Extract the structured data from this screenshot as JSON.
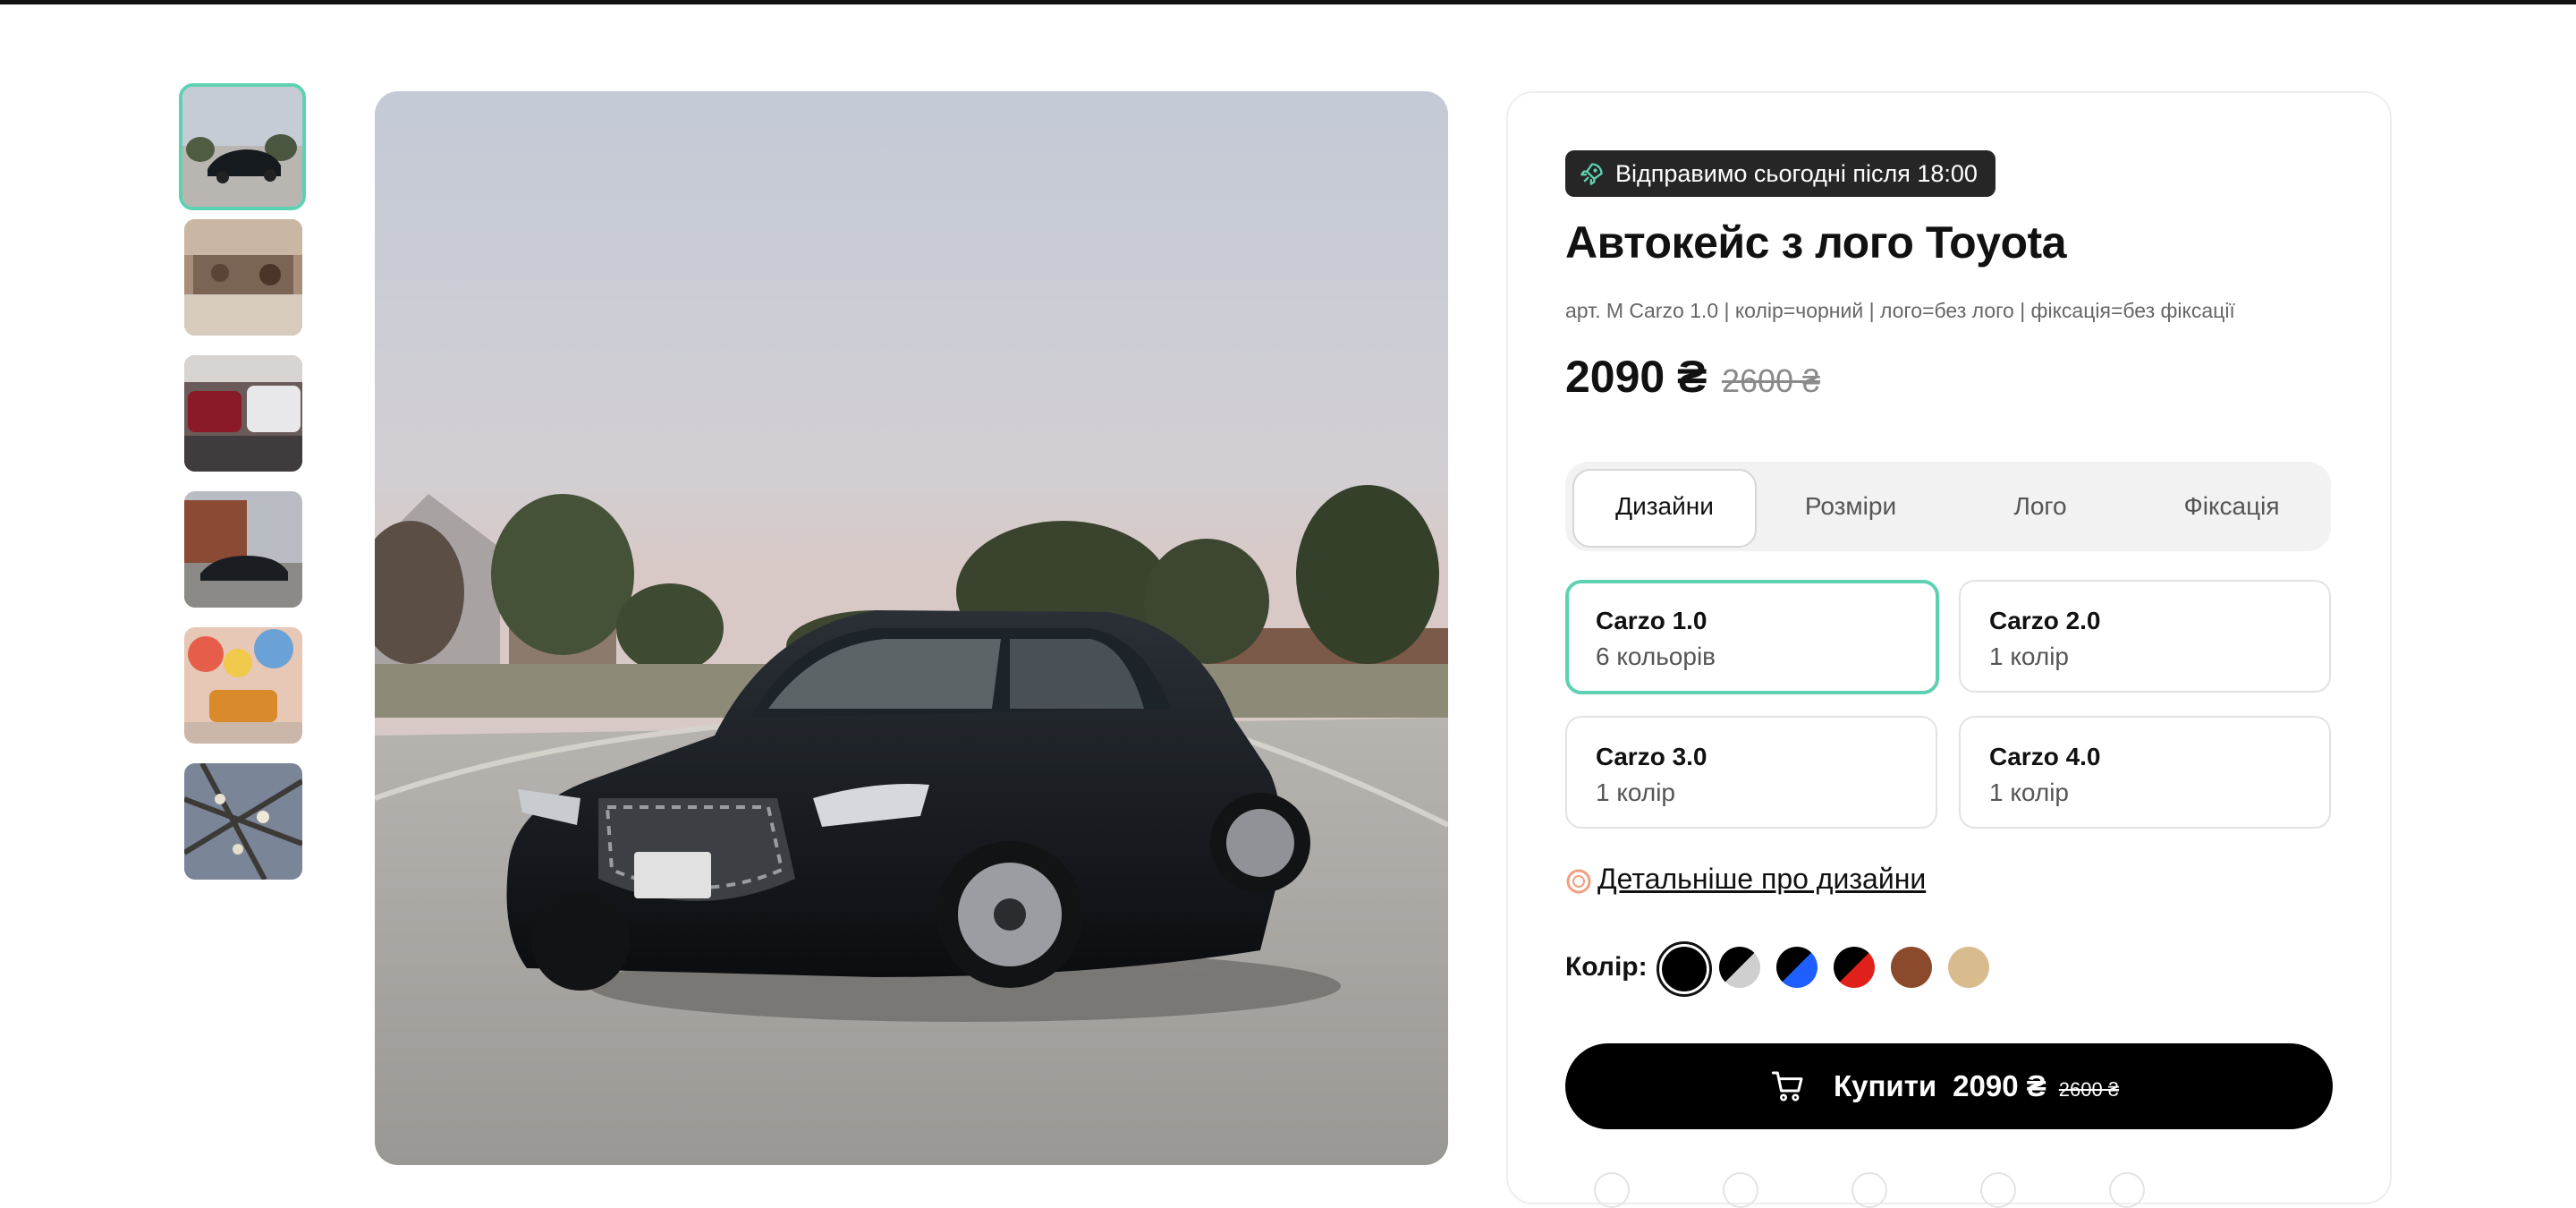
{
  "ship_badge": {
    "text": "Відправимо сьогодні після 18:00",
    "icon": "rocket-icon"
  },
  "product": {
    "title": "Автокейс з лого Toyota",
    "sku": "арт. M Carzo 1.0 | колір=чорний | лого=без лого | фіксація=без фіксації",
    "price": "2090 ₴",
    "old_price": "2600 ₴"
  },
  "tabs": [
    {
      "label": "Дизайни",
      "active": true
    },
    {
      "label": "Розміри",
      "active": false
    },
    {
      "label": "Лого",
      "active": false
    },
    {
      "label": "Фіксація",
      "active": false
    }
  ],
  "designs": [
    {
      "name": "Carzo 1.0",
      "sub": "6 кольорів",
      "selected": true
    },
    {
      "name": "Carzo 2.0",
      "sub": "1 колір",
      "selected": false
    },
    {
      "name": "Carzo 3.0",
      "sub": "1 колір",
      "selected": false
    },
    {
      "name": "Carzo 4.0",
      "sub": "1 колір",
      "selected": false
    }
  ],
  "more_link": "Детальніше про дизайни",
  "colors": {
    "label": "Колір:",
    "swatches": [
      {
        "name": "black",
        "fill": "#000000",
        "selected": true
      },
      {
        "name": "black-grey",
        "fill": "#000000",
        "fill2": "#cfcfcf"
      },
      {
        "name": "black-blue",
        "fill": "#000000",
        "fill2": "#1f5fff"
      },
      {
        "name": "black-red",
        "fill": "#000000",
        "fill2": "#e0201a"
      },
      {
        "name": "brown",
        "fill": "#8a4a2b"
      },
      {
        "name": "beige",
        "fill": "#d9bc8e"
      }
    ]
  },
  "buy": {
    "label": "Купити",
    "price": "2090 ₴",
    "old_price": "2600 ₴",
    "icon": "cart-icon"
  },
  "accent": "#5fd1b3",
  "thumbnails": [
    "car-on-road-photo",
    "showroom-photo",
    "parking-lot-cars-photo",
    "car-by-brick-house-photo",
    "toy-van-photo",
    "tree-branches-photo"
  ]
}
